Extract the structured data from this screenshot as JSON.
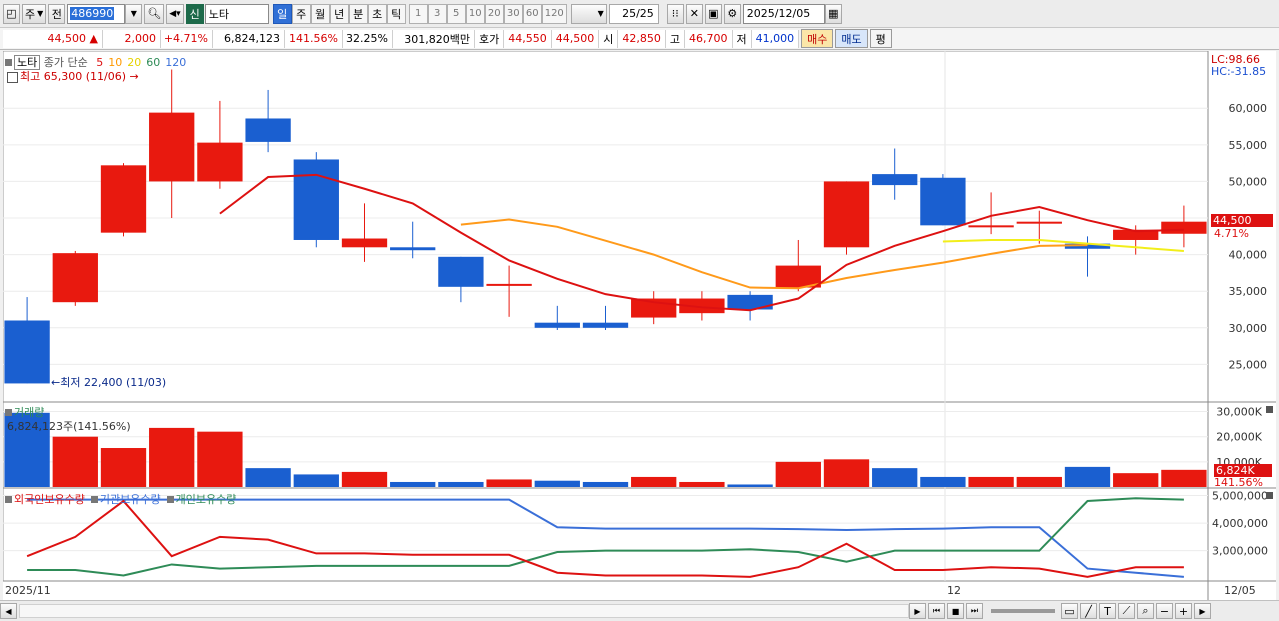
{
  "toolbar": {
    "period_type": "주",
    "prev_label": "전",
    "code": "486990",
    "shin_label": "신",
    "name": "노타",
    "periods": [
      "일",
      "주",
      "월",
      "년",
      "분",
      "초",
      "틱"
    ],
    "active_period": "일",
    "minutes": [
      "1",
      "3",
      "5",
      "10",
      "20",
      "30",
      "60",
      "120"
    ],
    "page": "25/25",
    "date": "2025/12/05"
  },
  "quote": {
    "price": "44,500",
    "arrow": "▲",
    "change": "2,000",
    "change_pct": "+4.71%",
    "volume": "6,824,123",
    "vol_ratio": "141.56%",
    "turnover": "32.25%",
    "amount": "301,820백만",
    "bid_label": "호가",
    "bid": "44,550",
    "ask": "44,500",
    "open_label": "시",
    "open": "42,850",
    "high_label": "고",
    "high": "46,700",
    "low_label": "저",
    "low": "41,000",
    "buy_label": "매수",
    "sell_label": "매도",
    "flat_label": "평"
  },
  "price_legend": {
    "name": "노타",
    "ma_title": "종가 단순",
    "ma_periods": [
      "5",
      "10",
      "20",
      "60",
      "120"
    ],
    "ma_colors": [
      "#dd1111",
      "#ff9900",
      "#e6d200",
      "#2e8b57",
      "#3a6fd8"
    ],
    "high_note": "최고 65,300 (11/06)",
    "low_note": "최저 22,400 (11/03)",
    "lc": "LC:98.66",
    "hc": "HC:-31.85"
  },
  "volume_legend": {
    "title": "거래량",
    "current": "6,824,123주(141.56%)",
    "current_short": "6,824K",
    "current_pct": "141.56%"
  },
  "holdings_legend": {
    "series": [
      "외국인보유수량",
      "기관보유수량",
      "개인보유수량"
    ]
  },
  "date_axis": {
    "start": "2025/11",
    "month_mark": "12",
    "end": "12/05"
  },
  "price_badge": {
    "value": "44,500",
    "pct": "4.71%"
  },
  "colors": {
    "up": "#e8190f",
    "down": "#1a5fd0",
    "ma5": "#dd1111",
    "ma10": "#ff9a1a",
    "ma20": "#f2ee1a",
    "foreign": "#dd1111",
    "institution": "#3a6fd8",
    "individual": "#2e8b57"
  },
  "chart_data": {
    "type": "candlestick",
    "dates": [
      "11/03",
      "11/04",
      "11/05",
      "11/06",
      "11/07",
      "11/10",
      "11/11",
      "11/12",
      "11/13",
      "11/14",
      "11/17",
      "11/18",
      "11/19",
      "11/20",
      "11/21",
      "11/24",
      "11/25",
      "11/26",
      "11/27",
      "11/28",
      "12/01",
      "12/02",
      "12/03",
      "12/04",
      "12/05"
    ],
    "ohlc": [
      [
        31000,
        34200,
        22400,
        22400
      ],
      [
        33500,
        40500,
        33000,
        40200
      ],
      [
        43000,
        52500,
        42500,
        52200
      ],
      [
        50000,
        65300,
        45000,
        59400
      ],
      [
        50000,
        61000,
        49000,
        55300
      ],
      [
        58600,
        62500,
        54000,
        55400
      ],
      [
        53000,
        54000,
        41000,
        42000
      ],
      [
        41000,
        47000,
        39000,
        42200
      ],
      [
        41000,
        44500,
        39500,
        40600
      ],
      [
        39700,
        39700,
        33500,
        35600
      ],
      [
        36000,
        38500,
        31500,
        36000
      ],
      [
        30700,
        33000,
        29700,
        30000
      ],
      [
        30700,
        33000,
        29700,
        30000
      ],
      [
        31400,
        35000,
        30500,
        34000
      ],
      [
        32000,
        35000,
        31000,
        34000
      ],
      [
        34500,
        35000,
        31000,
        32500
      ],
      [
        35500,
        42000,
        35000,
        38500
      ],
      [
        41000,
        50000,
        40000,
        50000
      ],
      [
        51000,
        54500,
        47500,
        49500
      ],
      [
        50500,
        51000,
        44000,
        44000
      ],
      [
        44000,
        48500,
        42800,
        44000
      ],
      [
        44500,
        46000,
        41500,
        44500
      ],
      [
        41500,
        42500,
        37000,
        40800
      ],
      [
        42000,
        44000,
        40000,
        43400
      ],
      [
        42850,
        46700,
        41000,
        44500
      ]
    ],
    "ma5": [
      null,
      null,
      null,
      null,
      45600,
      50600,
      50900,
      49000,
      47000,
      43000,
      39200,
      36700,
      34600,
      33500,
      32800,
      32400,
      34000,
      38600,
      41200,
      43200,
      45300,
      46500,
      44700,
      43200,
      43400
    ],
    "ma10": [
      null,
      null,
      null,
      null,
      null,
      null,
      null,
      null,
      null,
      44100,
      44800,
      43800,
      41900,
      40000,
      37600,
      35500,
      35400,
      36800,
      37900,
      38900,
      40100,
      41200,
      41300,
      null,
      null
    ],
    "ma20": [
      null,
      null,
      null,
      null,
      null,
      null,
      null,
      null,
      null,
      null,
      null,
      null,
      null,
      null,
      null,
      null,
      null,
      null,
      null,
      41800,
      42000,
      42000,
      41500,
      41000,
      40500
    ],
    "volume_k": [
      29500,
      20000,
      15500,
      23500,
      22000,
      7500,
      5000,
      6000,
      2000,
      2000,
      3000,
      2500,
      2000,
      4000,
      2000,
      1000,
      10000,
      11000,
      7500,
      4000,
      4000,
      4000,
      8000,
      5500,
      6824
    ],
    "volume_ylim": [
      0,
      33000
    ],
    "volume_ticks": [
      "30,000K",
      "20,000K",
      "10,000K"
    ],
    "foreign": [
      2800000,
      3500000,
      4800000,
      2800000,
      3500000,
      3400000,
      2900000,
      2900000,
      2850000,
      2850000,
      2850000,
      2200000,
      2100000,
      2100000,
      2100000,
      2050000,
      2400000,
      3250000,
      2300000,
      2300000,
      2400000,
      2350000,
      2050000,
      2400000,
      2400000
    ],
    "institution": [
      4850000,
      4850000,
      4850000,
      4850000,
      4850000,
      4850000,
      4850000,
      4850000,
      4850000,
      4850000,
      4850000,
      3850000,
      3800000,
      3800000,
      3800000,
      3800000,
      3780000,
      3750000,
      3780000,
      3800000,
      3850000,
      3850000,
      2350000,
      2200000,
      2050000
    ],
    "individual": [
      2300000,
      2300000,
      2100000,
      2500000,
      2350000,
      2400000,
      2450000,
      2450000,
      2450000,
      2450000,
      2450000,
      2950000,
      3000000,
      3000000,
      3000000,
      3050000,
      2950000,
      2600000,
      3000000,
      3000000,
      3000000,
      3000000,
      4800000,
      4900000,
      4850000
    ],
    "price_ylim": [
      20000,
      67000
    ],
    "price_ticks": [
      60000,
      55000,
      50000,
      45000,
      40000,
      35000,
      30000,
      25000
    ],
    "holdings_ylim": [
      1900000,
      5200000
    ],
    "holdings_ticks": [
      "5,000,000",
      "4,000,000",
      "3,000,000"
    ]
  }
}
